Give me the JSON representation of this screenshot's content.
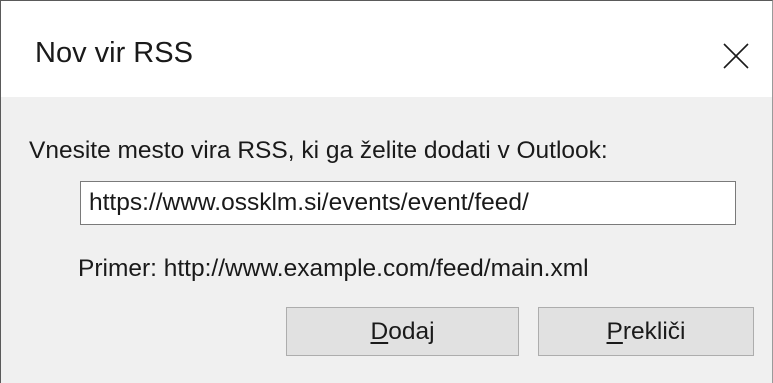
{
  "dialog": {
    "title": "Nov vir RSS",
    "close_icon": "close-icon"
  },
  "form": {
    "prompt": "Vnesite mesto vira RSS, ki ga želite dodati v Outlook:",
    "url_value": "https://www.ossklm.si/events/event/feed/",
    "example": "Primer: http://www.example.com/feed/main.xml"
  },
  "buttons": {
    "add": {
      "accel": "D",
      "rest": "odaj"
    },
    "cancel": {
      "accel": "P",
      "rest": "rekliči"
    }
  }
}
